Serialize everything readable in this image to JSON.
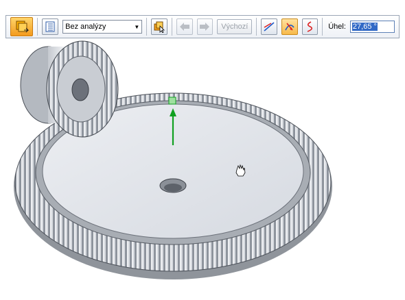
{
  "toolbar": {
    "analysis_select": {
      "value": "Bez analýzy"
    },
    "default_button": {
      "label": "Výchozí"
    },
    "angle": {
      "label": "Úhel:",
      "value": "27,65 °"
    }
  },
  "icons": [
    "orange-sheet-icon",
    "list-icon",
    "chevron-down-icon",
    "select-cursor-icon",
    "arrow-left-icon",
    "arrow-right-icon",
    "line-direction-icon",
    "rotate-direction-icon",
    "curve-icon"
  ],
  "colors": {
    "accent_orange": "#f39a1d",
    "axis_arrow_green": "#10a020",
    "selection_blue": "#3169c6"
  }
}
